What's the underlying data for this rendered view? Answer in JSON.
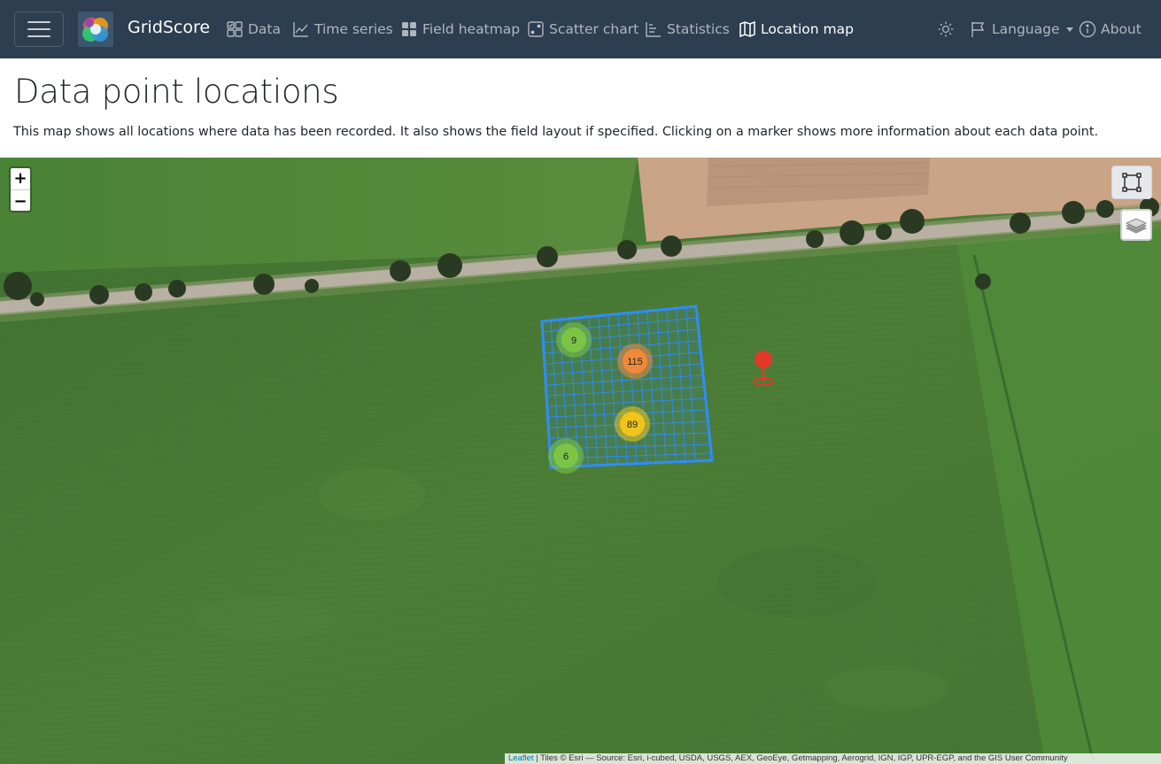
{
  "app": {
    "name": "GridScore"
  },
  "nav": {
    "items": [
      {
        "label": "Data",
        "icon": "data-icon"
      },
      {
        "label": "Time series",
        "icon": "time-series-icon"
      },
      {
        "label": "Field heatmap",
        "icon": "grid-icon"
      },
      {
        "label": "Scatter chart",
        "icon": "dice-icon"
      },
      {
        "label": "Statistics",
        "icon": "statistics-icon"
      },
      {
        "label": "Location map",
        "icon": "map-icon",
        "active": true
      }
    ],
    "language_label": "Language",
    "about_label": "About"
  },
  "page": {
    "title": "Data point locations",
    "description": "This map shows all locations where data has been recorded. It also shows the field layout if specified. Clicking on a marker shows more information about each data point."
  },
  "map": {
    "zoom_in": "+",
    "zoom_out": "−",
    "clusters": [
      {
        "count": "9",
        "color": "#7cc446"
      },
      {
        "count": "115",
        "color": "#f08a3a"
      },
      {
        "count": "89",
        "color": "#f0c419"
      },
      {
        "count": "6",
        "color": "#7cc446"
      }
    ],
    "marker_color": "#e3392b",
    "grid_color": "#2f8cff",
    "attribution_link": "Leaflet",
    "attribution_text": " | Tiles © Esri — Source: Esri, i-cubed, USDA, USGS, AEX, GeoEye, Getmapping, Aerogrid, IGN, IGP, UPR-EGP, and the GIS User Community"
  },
  "colors": {
    "navbar": "#2c3e50",
    "field": "#4a7a35"
  }
}
